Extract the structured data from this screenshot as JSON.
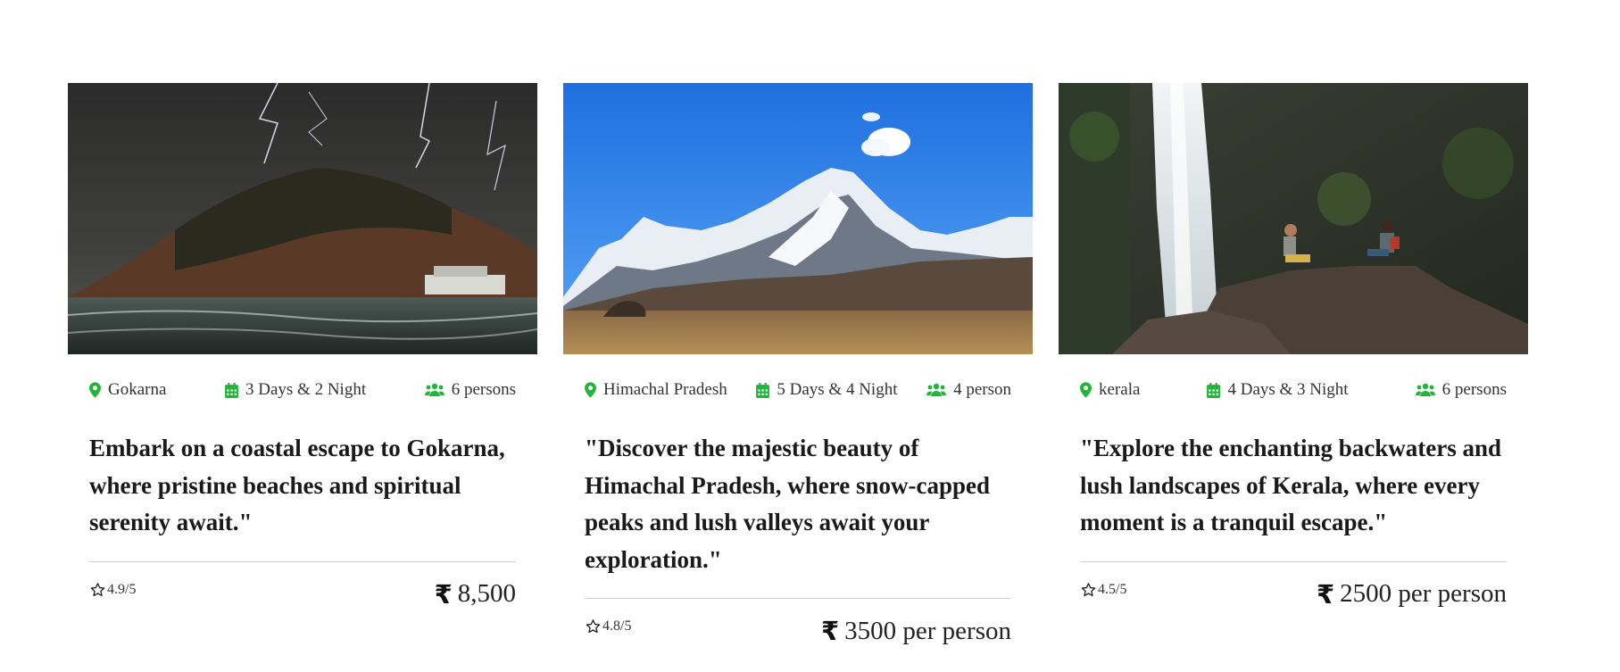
{
  "colors": {
    "accent": "#22b53a",
    "text": "#212529",
    "divider": "#cfcfcf"
  },
  "cards": [
    {
      "image_subject": "stormy coastal hill at Gokarna",
      "location": "Gokarna",
      "duration": "3 Days & 2 Night",
      "persons": "6 persons",
      "description": "Embark on a coastal escape to Gokarna, where pristine beaches and spiritual serenity await.\"",
      "rating": "4.9/5",
      "currency_symbol": "₹",
      "price": "8,500"
    },
    {
      "image_subject": "snow-capped mountain peak in Himachal Pradesh",
      "location": "Himachal Pradesh",
      "duration": "5 Days & 4 Night",
      "persons": "4 person",
      "description": "\"Discover the majestic beauty of Himachal Pradesh, where snow-capped peaks and lush valleys await your exploration.\"",
      "rating": "4.8/5",
      "currency_symbol": "₹",
      "price": "3500 per person"
    },
    {
      "image_subject": "waterfall with two people on rocks in Kerala",
      "location": "kerala",
      "duration": "4 Days & 3 Night",
      "persons": "6 persons",
      "description": "\"Explore the enchanting backwaters and lush landscapes of Kerala, where every moment is a tranquil escape.\"",
      "rating": "4.5/5",
      "currency_symbol": "₹",
      "price": "2500 per person"
    }
  ],
  "icons": {
    "location": "map-pin-icon",
    "duration": "calendar-icon",
    "persons": "users-icon",
    "rating": "star-outline-icon",
    "currency": "rupee-icon"
  }
}
